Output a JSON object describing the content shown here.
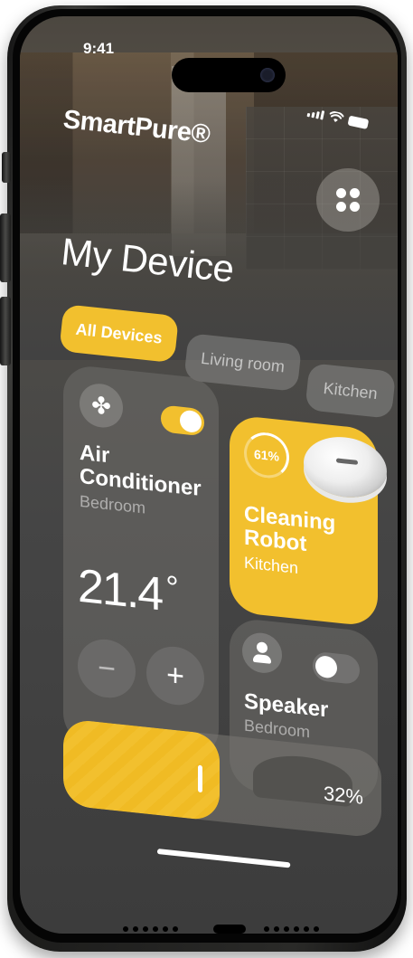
{
  "status_bar": {
    "time": "9:41"
  },
  "header": {
    "app_title": "SmartPure®",
    "page_title": "My Device"
  },
  "filters": [
    {
      "label": "All Devices",
      "active": true
    },
    {
      "label": "Living room",
      "active": false
    },
    {
      "label": "Kitchen",
      "active": false
    }
  ],
  "devices": {
    "air_conditioner": {
      "name": "Air Conditioner",
      "room": "Bedroom",
      "temperature": "21.4",
      "unit": "°",
      "minus": "−",
      "plus": "+",
      "on": true
    },
    "cleaning_robot": {
      "name": "Cleaning Robot",
      "room": "Kitchen",
      "progress": "61%"
    },
    "speaker": {
      "name": "Speaker",
      "room": "Bedroom",
      "on": false
    }
  },
  "slider": {
    "value": "32%",
    "fraction": 0.32
  },
  "colors": {
    "accent": "#f2c02e",
    "card": "#706e6a",
    "text": "#ffffff"
  },
  "icons": {
    "menu": "grid-icon",
    "ac": "fan-icon",
    "speaker": "user-icon",
    "robot": "robot-vacuum-image"
  }
}
